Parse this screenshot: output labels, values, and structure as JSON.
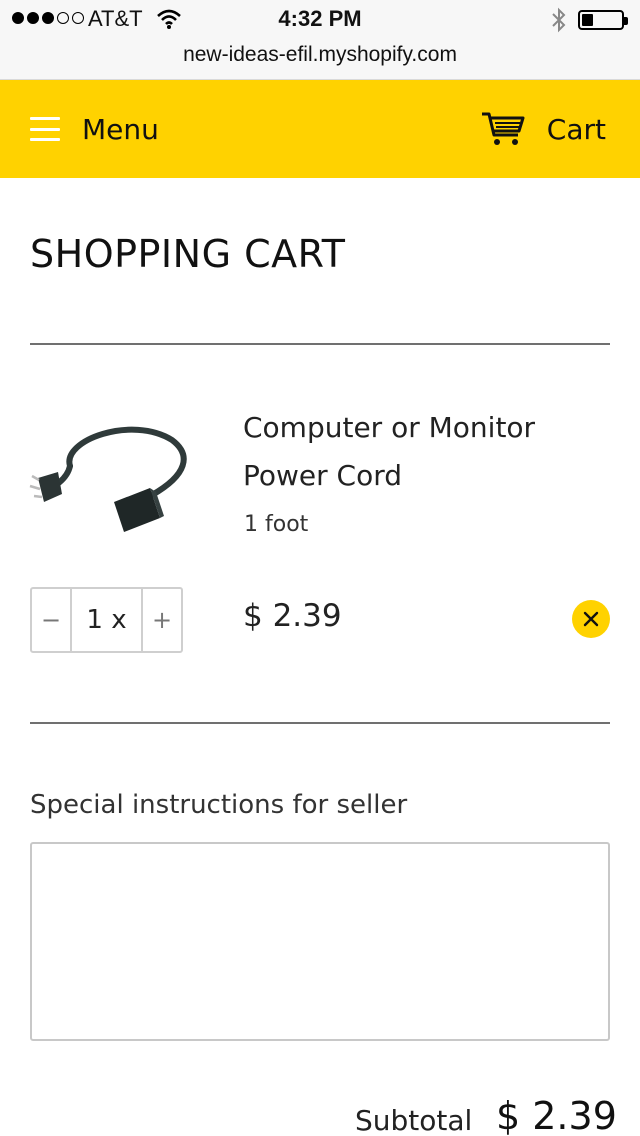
{
  "status_bar": {
    "carrier": "AT&T",
    "time": "4:32 PM",
    "signal_icon": "signal-dots-icon",
    "wifi_icon": "wifi-icon",
    "bluetooth_icon": "bluetooth-icon",
    "battery_icon": "battery-icon",
    "battery_level": 0.3
  },
  "browser": {
    "url": "new-ideas-efil.myshopify.com"
  },
  "header": {
    "menu_label": "Menu",
    "cart_label": "Cart",
    "menu_icon": "hamburger-icon",
    "cart_icon": "shopping-cart-icon",
    "accent_color": "#ffd200"
  },
  "page": {
    "title": "SHOPPING CART"
  },
  "cart_item": {
    "title": "Computer or Monitor Power Cord",
    "variant": "1 foot",
    "quantity": "1 x",
    "decrement_label": "−",
    "increment_label": "+",
    "price": "$ 2.39",
    "image_icon": "power-cord-image",
    "remove_icon": "close-icon"
  },
  "instructions": {
    "label": "Special instructions for seller",
    "value": ""
  },
  "summary": {
    "subtotal_label": "Subtotal",
    "subtotal_value": "$ 2.39"
  }
}
